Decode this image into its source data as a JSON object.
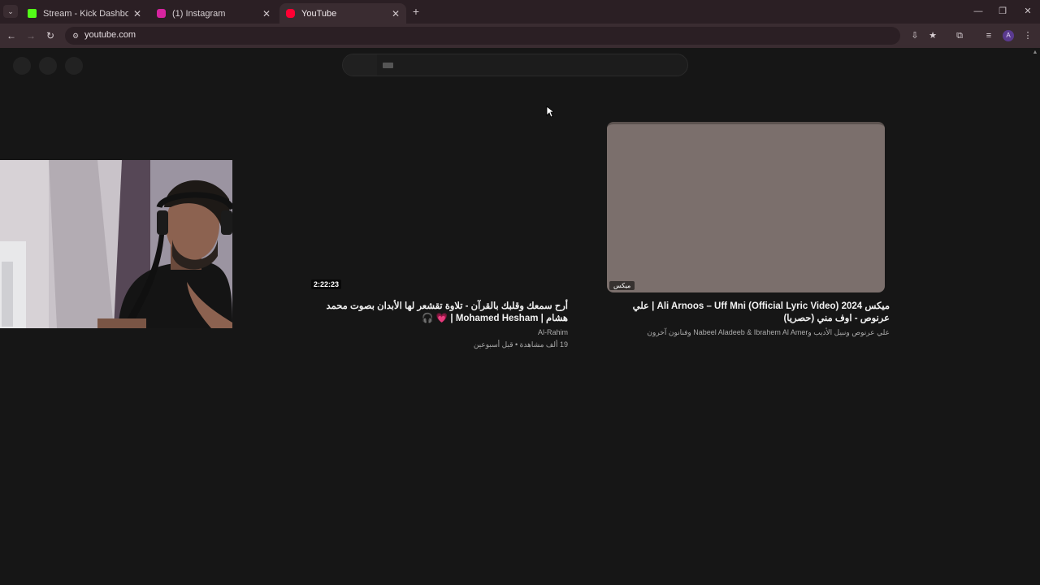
{
  "browser": {
    "tabs": [
      {
        "title": "Stream - Kick Dashboard",
        "favicon_color": "#53fc18",
        "icon": "kick-icon"
      },
      {
        "title": "(1) Instagram",
        "favicon_color": "#d6249f",
        "icon": "instagram-icon"
      },
      {
        "title": "YouTube",
        "favicon_color": "#ff0033",
        "icon": "youtube-icon"
      }
    ],
    "active_tab": 2,
    "url": "youtube.com",
    "profile_initial": "A"
  },
  "videos": [
    {
      "duration": "2:22:23",
      "title": "أرح سمعك وقلبك بالقرآن - تلاوة تقشعر لها الأبدان بصوت محمد هشام | Mohamed Hesham | 💗 🎧",
      "channel": "Al-Rahim",
      "meta": "19 ألف مشاهدة • قبل أسبوعين"
    },
    {
      "badge": "ميكس",
      "title": "ميكس Ali Arnoos – Uff Mni (Official Lyric Video) 2024 | علي عرنوص - اوف مني (حصريا)",
      "channel": "علي عرنوص ونبيل الأديب وNabeel Aladeeb & Ibrahem Al Amer وفنانون آخرون"
    }
  ],
  "colors": {
    "page_bg": "#161616",
    "tab_strip": "#2b1f24",
    "toolbar": "#3a2c31",
    "thumbnail": "#7b6f6c"
  }
}
